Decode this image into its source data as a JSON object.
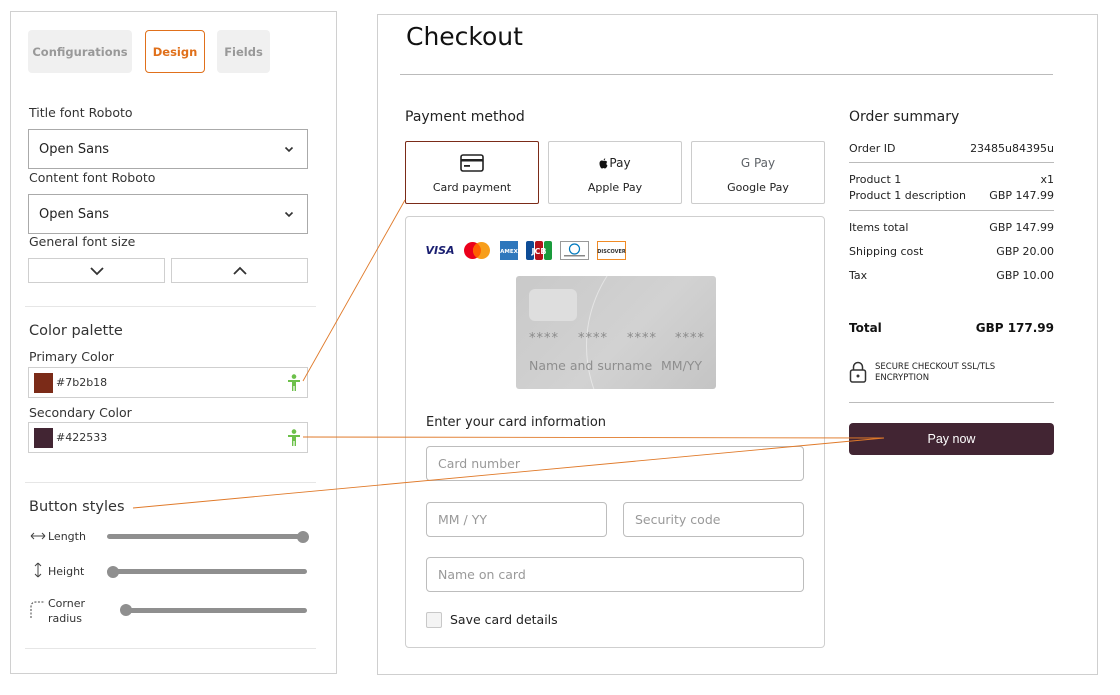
{
  "settings": {
    "tabs": [
      {
        "label": "Configurations"
      },
      {
        "label": "Design"
      },
      {
        "label": "Fields"
      }
    ],
    "title_font_label": "Title font Roboto",
    "title_font_value": "Open Sans",
    "content_font_label": "Content font Roboto",
    "content_font_value": "Open Sans",
    "general_font_size_label": "General font size",
    "color_palette_title": "Color palette",
    "primary_color_label": "Primary Color",
    "primary_color_value": "#7b2b18",
    "secondary_color_label": "Secondary Color",
    "secondary_color_value": "#422533",
    "button_styles_title": "Button styles",
    "sliders": [
      {
        "label": "Length",
        "value": 1.0
      },
      {
        "label": "Height",
        "value": 0.0
      },
      {
        "label": "Corner\nradius",
        "value": 0.0
      }
    ]
  },
  "checkout": {
    "title": "Checkout",
    "payment_method_title": "Payment method",
    "payment_options": [
      {
        "label": "Card payment",
        "icon": "credit-card-icon",
        "selected": true
      },
      {
        "label": "Apple Pay",
        "icon_text": "Pay",
        "icon": "apple-pay-icon"
      },
      {
        "label": "Google Pay",
        "icon_text": "G Pay",
        "icon": "google-pay-icon"
      }
    ],
    "card_brands": [
      "VISA",
      "Mastercard",
      "AMEX",
      "JCB",
      "Diners Club",
      "DISCOVER"
    ],
    "card_preview": {
      "number_groups": [
        "****",
        "****",
        "****",
        "****"
      ],
      "name_placeholder": "Name and surname",
      "expiry_placeholder": "MM/YY"
    },
    "enter_card_title": "Enter your card information",
    "fields": {
      "card_number": "Card number",
      "expiry": "MM / YY",
      "security_code": "Security code",
      "name_on_card": "Name on card"
    },
    "save_card_label": "Save card details"
  },
  "order_summary": {
    "title": "Order summary",
    "order_id_label": "Order ID",
    "order_id_value": "23485u84395u",
    "product_name": "Product 1",
    "product_qty": "x1",
    "product_description": "Product 1 description",
    "product_price": "GBP 147.99",
    "items_total_label": "Items total",
    "items_total_value": "GBP 147.99",
    "shipping_label": "Shipping cost",
    "shipping_value": "GBP 20.00",
    "tax_label": "Tax",
    "tax_value": "GBP 10.00",
    "total_label": "Total",
    "total_value": "GBP 177.99",
    "secure_text": "SECURE CHECKOUT SSL/TLS ENCRYPTION",
    "pay_button_label": "Pay now"
  },
  "colors": {
    "accent": "#e0701b",
    "primary": "#7b2b18",
    "secondary": "#422533",
    "annotation_line": "#e07a2a",
    "person_icon": "#6cc04a"
  }
}
